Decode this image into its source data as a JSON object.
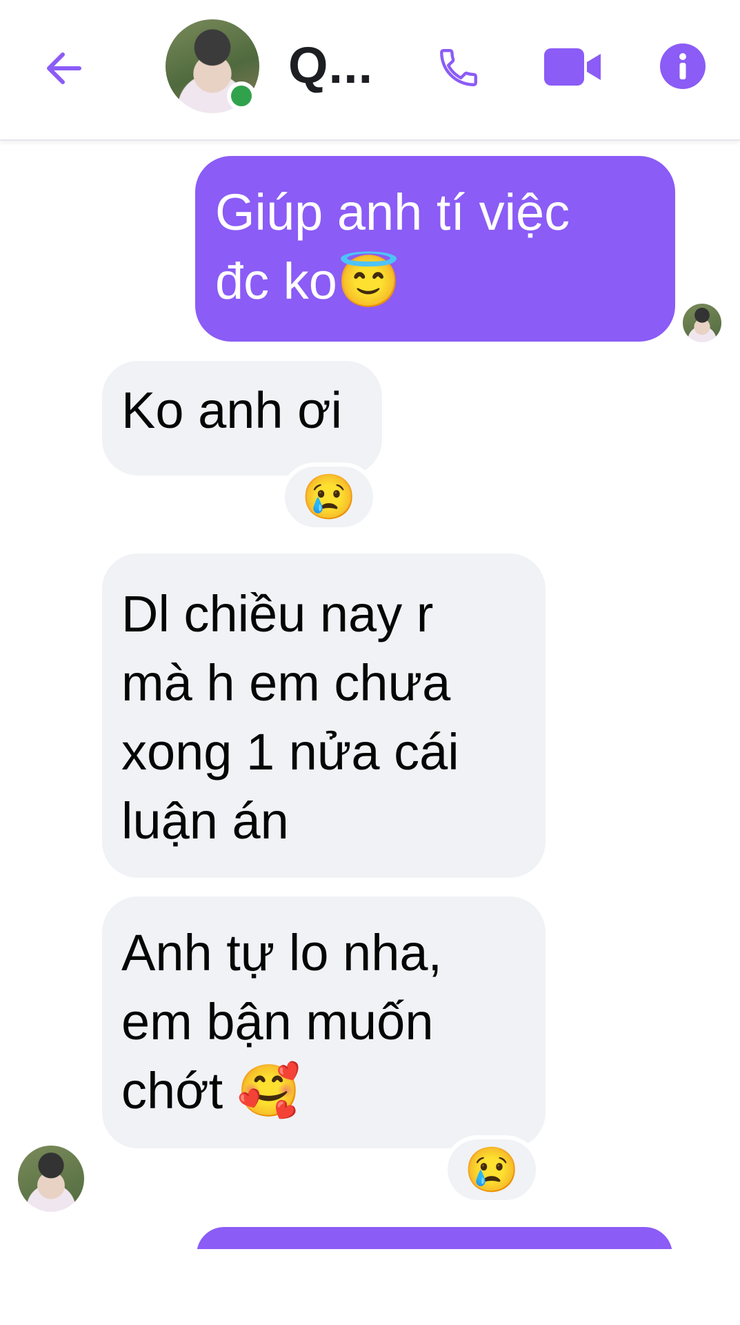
{
  "header": {
    "contact_name": "Q...",
    "icons": {
      "back": "arrow-left-icon",
      "call": "phone-icon",
      "video": "video-camera-icon",
      "info": "info-icon"
    },
    "accent_color": "#8b5cf6",
    "online_color": "#31a24c"
  },
  "messages": [
    {
      "direction": "outgoing",
      "text": "Giúp anh tí việc\nđc ko😇"
    },
    {
      "direction": "incoming",
      "text": "Ko anh ơi",
      "reaction": "😢"
    },
    {
      "direction": "incoming",
      "text": "Dl chiều nay r\nmà h em chưa\nxong 1 nửa cái\nluận án"
    },
    {
      "direction": "incoming",
      "text": "Anh tự lo nha,\nem bận muốn\nchớt 🥰",
      "reaction": "😢"
    }
  ]
}
